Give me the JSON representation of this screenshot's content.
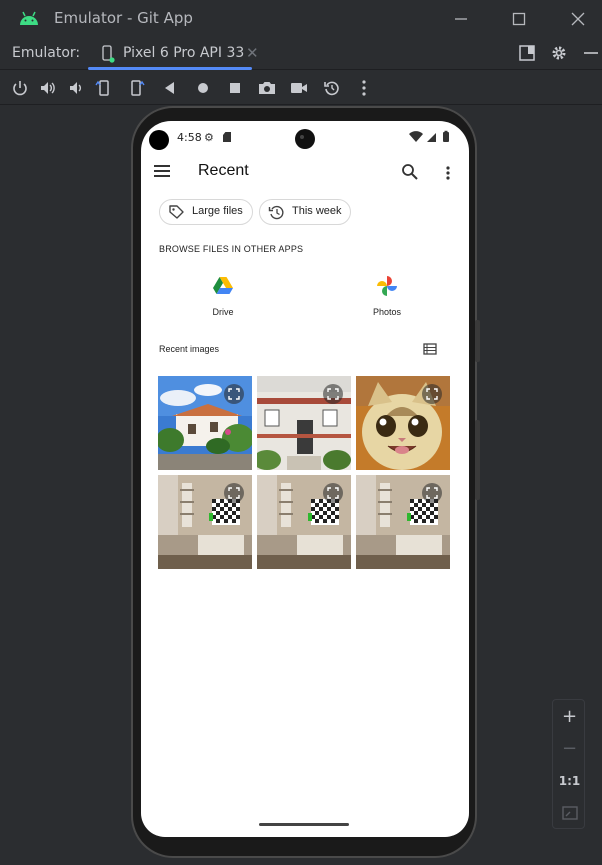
{
  "window": {
    "title": "Emulator - Git App",
    "accent_color": "#3ddc84"
  },
  "tabstrip": {
    "label": "Emulator:",
    "tab_label": "Pixel 6 Pro API 33",
    "close_glyph": "✕",
    "tab_accent": "#548af7"
  },
  "toolbar": {
    "icons": [
      "power-icon",
      "volume-up-icon",
      "volume-down-icon",
      "rotate-left-icon",
      "rotate-right-icon",
      "back-icon",
      "home-icon",
      "overview-icon",
      "camera-icon",
      "record-icon",
      "replay-icon",
      "more-icon"
    ]
  },
  "phone": {
    "status": {
      "time": "4:58",
      "gear": "⚙"
    },
    "appbar": {
      "title": "Recent"
    },
    "chips": [
      {
        "label": "Large files",
        "icon": "tag-icon"
      },
      {
        "label": "This week",
        "icon": "history-icon"
      }
    ],
    "browse_title": "BROWSE FILES IN OTHER APPS",
    "apps": [
      {
        "label": "Drive",
        "icon": "google-drive-icon"
      },
      {
        "label": "Photos",
        "icon": "google-photos-icon"
      }
    ],
    "recent_title": "Recent images",
    "images": [
      {
        "subject": "house-with-garden"
      },
      {
        "subject": "white-house-entrance"
      },
      {
        "subject": "smiling-cat"
      },
      {
        "subject": "room-with-checkered-tv"
      },
      {
        "subject": "room-with-checkered-tv"
      },
      {
        "subject": "room-with-checkered-tv"
      }
    ]
  },
  "zoom": {
    "plus": "+",
    "minus": "−",
    "ratio": "1:1"
  }
}
